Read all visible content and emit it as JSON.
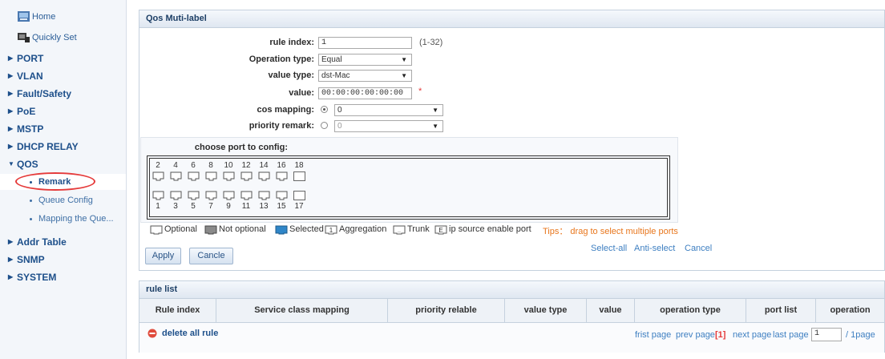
{
  "sidebar": {
    "home": "Home",
    "quick_set": "Quickly Set",
    "sections": [
      "PORT",
      "VLAN",
      "Fault/Safety",
      "PoE",
      "MSTP",
      "DHCP RELAY",
      "QOS"
    ],
    "qos_items": [
      "Remark",
      "Queue Config",
      "Mapping the Que..."
    ],
    "sections_after": [
      "Addr Table",
      "SNMP",
      "SYSTEM"
    ]
  },
  "qos_panel": {
    "title": "Qos Muti-label",
    "rule_index": {
      "label": "rule index:",
      "value": "1",
      "hint": "(1-32)"
    },
    "operation_type": {
      "label": "Operation type:",
      "value": "Equal"
    },
    "value_type": {
      "label": "value type:",
      "value": "dst-Mac"
    },
    "value": {
      "label": "value:",
      "value": "00:00:00:00:00:00",
      "required": "*"
    },
    "cos_mapping": {
      "label": "cos mapping:",
      "value": "0",
      "selected": true
    },
    "priority_remark": {
      "label": "priority remark:",
      "value": "0",
      "selected": false
    },
    "choose_port_label": "choose port to config:",
    "ports_top": [
      "2",
      "4",
      "6",
      "8",
      "10",
      "12",
      "14",
      "16",
      "18"
    ],
    "ports_bottom": [
      "1",
      "3",
      "5",
      "7",
      "9",
      "11",
      "13",
      "15",
      "17"
    ],
    "legend": {
      "optional": "Optional",
      "not_optional": "Not optional",
      "selected": "Selected",
      "aggregation": "Aggregation",
      "trunk": "Trunk",
      "ip_source": "ip source enable port",
      "tips": "Tips： drag to select multiple ports"
    },
    "links": {
      "select_all": "Select-all",
      "anti_select": "Anti-select",
      "cancel": "Cancel"
    },
    "apply": "Apply",
    "cancle": "Cancle"
  },
  "rule_list": {
    "title": "rule list",
    "columns": [
      "Rule index",
      "Service class mapping",
      "priority relable",
      "value type",
      "value",
      "operation type",
      "port list",
      "operation"
    ],
    "delete_all": "delete all rule",
    "pager": {
      "first": "frist page",
      "prev": "prev page",
      "current": "[1]",
      "next": "next page",
      "last": "last page",
      "page_input": "1",
      "total": "/ 1page"
    }
  },
  "colors": {
    "accent": "#2a5d97",
    "tips": "#e8761c",
    "highlight_circle": "#e53b3b",
    "selected_port": "#2f86c8",
    "delete_icon": "#e04b3c"
  }
}
